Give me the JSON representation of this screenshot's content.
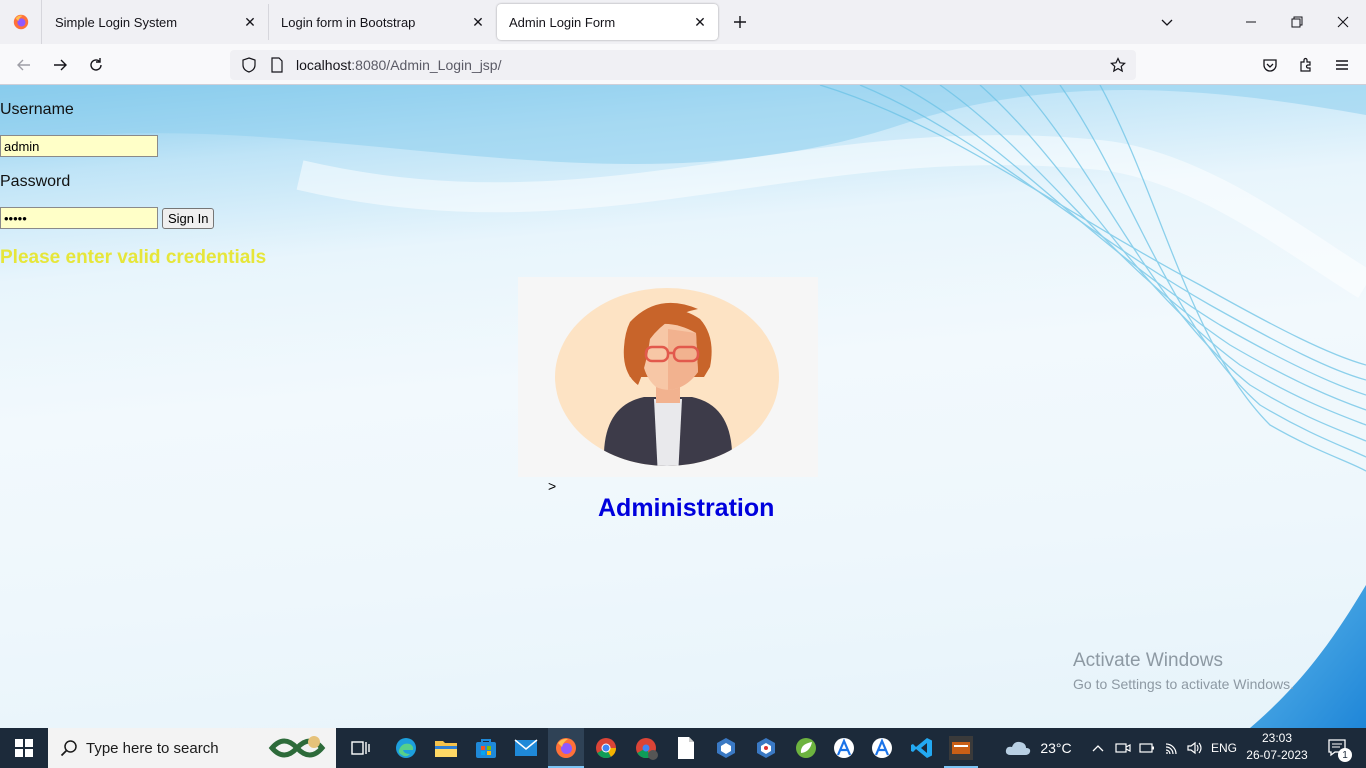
{
  "browser": {
    "tabs": [
      {
        "title": "Simple Login System"
      },
      {
        "title": "Login form in Bootstrap"
      },
      {
        "title": "Admin Login Form"
      }
    ],
    "url_host": "localhost",
    "url_path": ":8080/Admin_Login_jsp/"
  },
  "form": {
    "username_label": "Username",
    "username_value": "admin",
    "password_label": "Password",
    "password_value": "admin",
    "signin_label": "Sign In",
    "error_message": "Please enter valid credentials"
  },
  "page": {
    "stray_char": ">",
    "title": "Administration"
  },
  "watermark": {
    "line1": "Activate Windows",
    "line2": "Go to Settings to activate Windows."
  },
  "taskbar": {
    "search_placeholder": "Type here to search",
    "weather": "23°C",
    "language": "ENG",
    "time": "23:03",
    "date": "26-07-2023",
    "notification_count": "1"
  },
  "colors": {
    "error": "#e6e63a",
    "title": "#0000dd",
    "input_bg": "#ffffc8"
  }
}
